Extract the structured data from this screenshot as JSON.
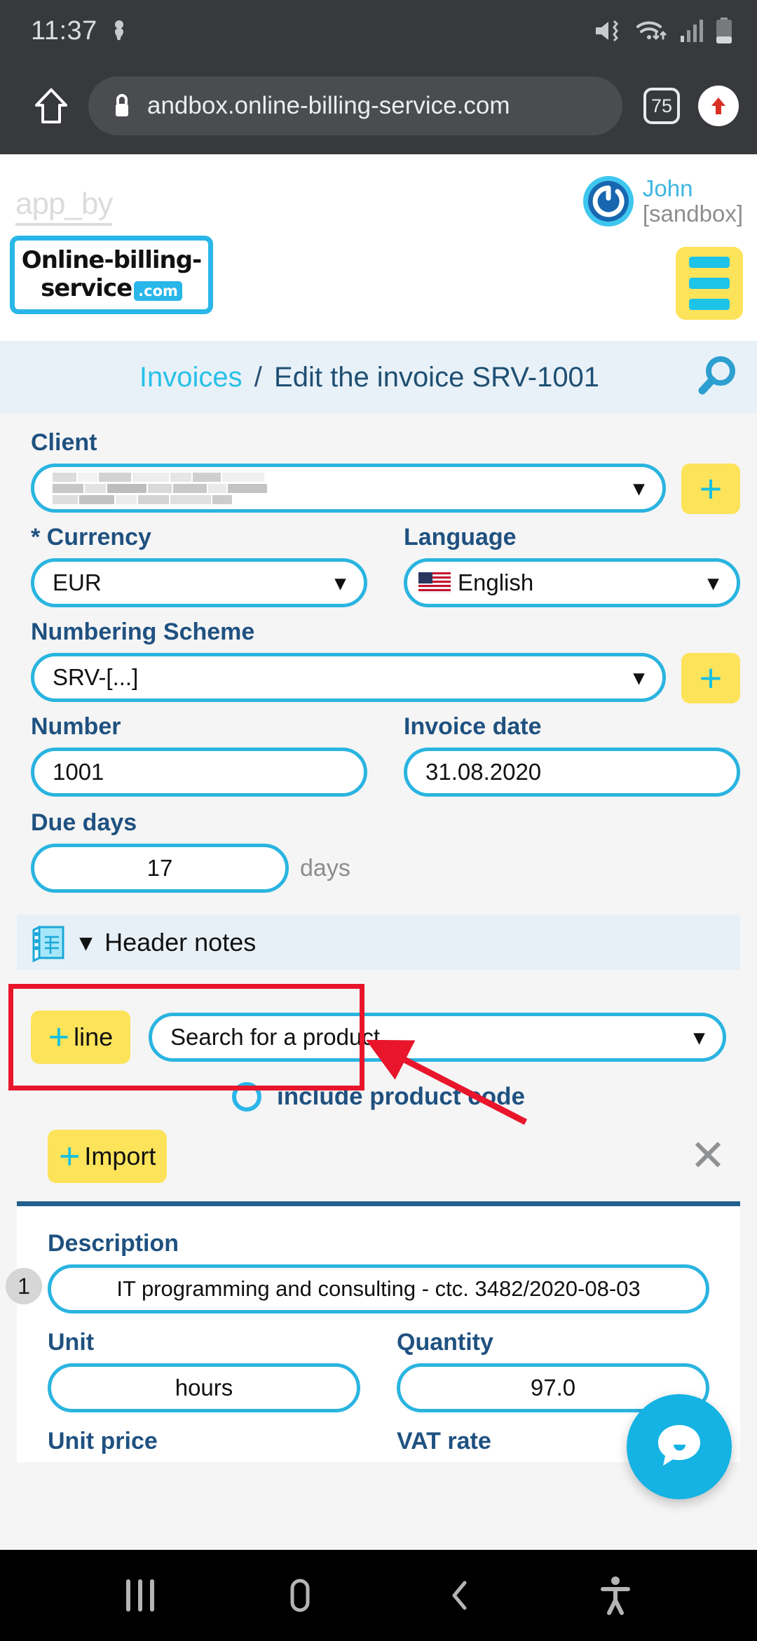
{
  "status_bar": {
    "time": "11:37",
    "icons": [
      "vibrate-muted-icon",
      "wifi-icon",
      "signal-icon",
      "battery-icon"
    ]
  },
  "browser": {
    "home_icon": "home-icon",
    "lock_icon": "lock-icon",
    "url": "andbox.online-billing-service.com",
    "tab_count": "75",
    "update_icon": "upload-arrow-icon"
  },
  "app_header": {
    "watermark": "app_by",
    "logo": {
      "line1": "Online-billing-",
      "line2": "service",
      "tld": ".com"
    },
    "user": {
      "name": "John",
      "environment": "[sandbox]",
      "avatar_icon": "power-icon"
    },
    "menu_icon": "hamburger-menu-icon"
  },
  "breadcrumb": {
    "parent": "Invoices",
    "separator": "/",
    "current": "Edit the invoice SRV-1001",
    "search_icon": "search-icon"
  },
  "form": {
    "client": {
      "label": "Client",
      "value": "",
      "redacted": true,
      "add_label": "+"
    },
    "currency": {
      "label": "* Currency",
      "value": "EUR"
    },
    "language": {
      "label": "Language",
      "value": "English",
      "flag": "us-flag-icon"
    },
    "numbering_scheme": {
      "label": "Numbering Scheme",
      "value": "SRV-[...]",
      "add_label": "+"
    },
    "number": {
      "label": "Number",
      "value": "1001"
    },
    "invoice_date": {
      "label": "Invoice date",
      "value": "31.08.2020"
    },
    "due_days": {
      "label": "Due days",
      "value": "17",
      "suffix": "days"
    },
    "header_notes": {
      "label": "Header notes",
      "icon": "notepad-icon",
      "chevron": "chevron-down-icon"
    }
  },
  "products": {
    "add_line_label": "line",
    "add_line_plus": "+",
    "search_placeholder": "Search for a product",
    "include_product_code": "include product code",
    "import_label": "Import",
    "import_plus": "+",
    "close_icon": "close-icon"
  },
  "line_item": {
    "row_number": "1",
    "description": {
      "label": "Description",
      "value": "IT programming and consulting - ctc. 3482/2020-08-03"
    },
    "unit": {
      "label": "Unit",
      "value": "hours"
    },
    "quantity": {
      "label": "Quantity",
      "value": "97.0"
    },
    "unit_price": {
      "label": "Unit price"
    },
    "vat_rate": {
      "label": "VAT rate"
    }
  },
  "chat": {
    "icon": "chat-bubble-icon"
  },
  "annotation": {
    "highlight": "due-days-field",
    "arrow": "red-arrow"
  },
  "nav_bar": {
    "recents": "recents-icon",
    "home": "home-icon",
    "back": "back-icon",
    "accessibility": "accessibility-icon"
  },
  "colors": {
    "accent_cyan": "#29b6e8",
    "yellow": "#fce35a",
    "navy": "#1f5180",
    "annotation_red": "#e8152b",
    "section_bg": "#e7f0f7"
  }
}
